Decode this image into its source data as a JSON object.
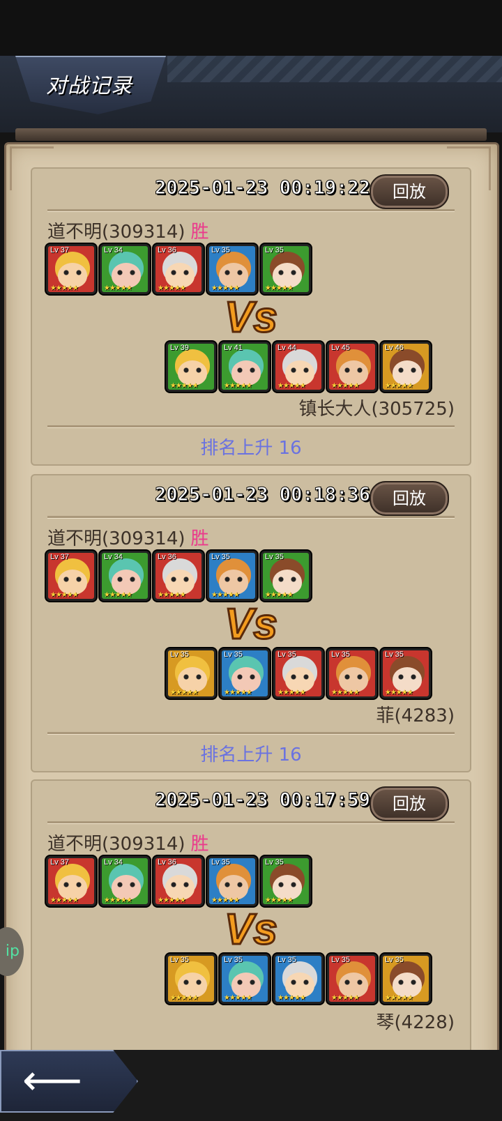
{
  "header": {
    "title": "对战记录"
  },
  "nav": {
    "back_icon": "left-arrow-icon",
    "side_label": "ip"
  },
  "colors": {
    "win": "#ea3b8c",
    "rank": "#6a72e0",
    "panel": "#d8c9ad"
  },
  "battles": [
    {
      "time": "2025-01-23 00:19:22",
      "replay_label": "回放",
      "player": "道不明(309314)",
      "result": "胜",
      "vs_label": "Vs",
      "player_team": [
        {
          "level": "Lv 37",
          "frame": "red"
        },
        {
          "level": "Lv 34",
          "frame": "green"
        },
        {
          "level": "Lv 36",
          "frame": "red"
        },
        {
          "level": "Lv 35",
          "frame": "blue"
        },
        {
          "level": "Lv 35",
          "frame": "green"
        }
      ],
      "opponent_team": [
        {
          "level": "Lv 39",
          "frame": "green"
        },
        {
          "level": "Lv 41",
          "frame": "green"
        },
        {
          "level": "Lv 44",
          "frame": "red"
        },
        {
          "level": "Lv 45",
          "frame": "red"
        },
        {
          "level": "Lv 46",
          "frame": "gold"
        }
      ],
      "opponent": "镇长大人(305725)",
      "rank_change": "排名上升 16"
    },
    {
      "time": "2025-01-23 00:18:36",
      "replay_label": "回放",
      "player": "道不明(309314)",
      "result": "胜",
      "vs_label": "Vs",
      "player_team": [
        {
          "level": "Lv 37",
          "frame": "red"
        },
        {
          "level": "Lv 34",
          "frame": "green"
        },
        {
          "level": "Lv 36",
          "frame": "red"
        },
        {
          "level": "Lv 35",
          "frame": "blue"
        },
        {
          "level": "Lv 35",
          "frame": "green"
        }
      ],
      "opponent_team": [
        {
          "level": "Lv 35",
          "frame": "gold"
        },
        {
          "level": "Lv 35",
          "frame": "blue"
        },
        {
          "level": "Lv 35",
          "frame": "red"
        },
        {
          "level": "Lv 35",
          "frame": "red"
        },
        {
          "level": "Lv 35",
          "frame": "red"
        }
      ],
      "opponent": "菲(4283)",
      "rank_change": "排名上升 16"
    },
    {
      "time": "2025-01-23 00:17:59",
      "replay_label": "回放",
      "player": "道不明(309314)",
      "result": "胜",
      "vs_label": "Vs",
      "player_team": [
        {
          "level": "Lv 37",
          "frame": "red"
        },
        {
          "level": "Lv 34",
          "frame": "green"
        },
        {
          "level": "Lv 36",
          "frame": "red"
        },
        {
          "level": "Lv 35",
          "frame": "blue"
        },
        {
          "level": "Lv 35",
          "frame": "green"
        }
      ],
      "opponent_team": [
        {
          "level": "Lv 35",
          "frame": "gold"
        },
        {
          "level": "Lv 35",
          "frame": "blue"
        },
        {
          "level": "Lv 35",
          "frame": "blue"
        },
        {
          "level": "Lv 35",
          "frame": "red"
        },
        {
          "level": "Lv 35",
          "frame": "gold"
        }
      ],
      "opponent": "琴(4228)",
      "rank_change": ""
    }
  ]
}
